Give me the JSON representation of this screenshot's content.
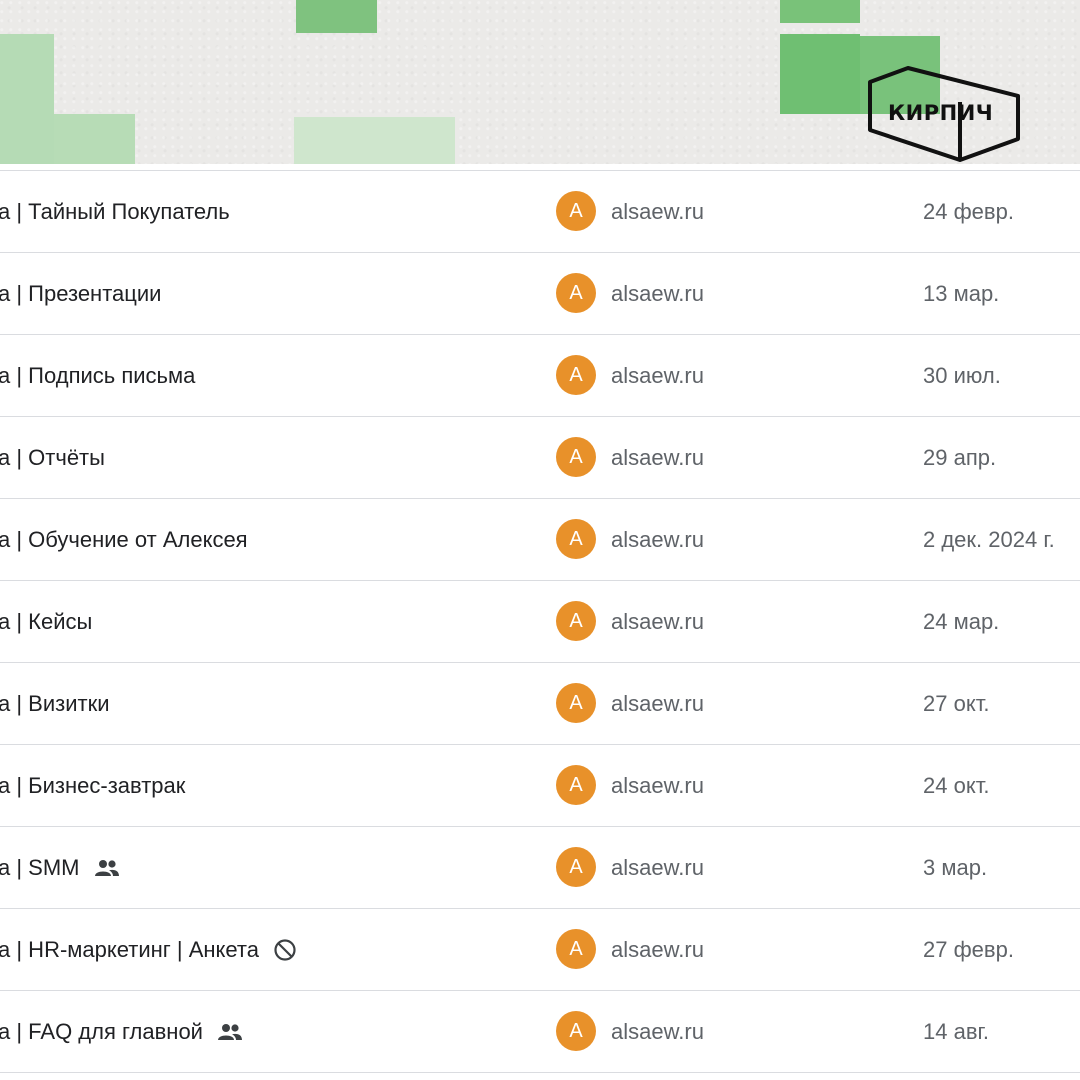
{
  "header": {
    "logo_text": "КИРПИЧ"
  },
  "colors": {
    "avatar_bg": "#e8912a",
    "divider": "#dadce0",
    "text_primary": "#202124",
    "text_secondary": "#5f6368"
  },
  "rows": [
    {
      "title": "а | Тайный Покупатель",
      "avatar_letter": "A",
      "owner": "alsaew.ru",
      "date": "24 февр.",
      "flag_icon": ""
    },
    {
      "title": "а | Презентации",
      "avatar_letter": "A",
      "owner": "alsaew.ru",
      "date": "13 мар.",
      "flag_icon": ""
    },
    {
      "title": "а | Подпись письма",
      "avatar_letter": "A",
      "owner": "alsaew.ru",
      "date": "30 июл.",
      "flag_icon": ""
    },
    {
      "title": "а | Отчёты",
      "avatar_letter": "A",
      "owner": "alsaew.ru",
      "date": "29 апр.",
      "flag_icon": ""
    },
    {
      "title": "а | Обучение от Алексея",
      "avatar_letter": "A",
      "owner": "alsaew.ru",
      "date": "2 дек. 2024 г.",
      "flag_icon": ""
    },
    {
      "title": "а | Кейсы",
      "avatar_letter": "A",
      "owner": "alsaew.ru",
      "date": "24 мар.",
      "flag_icon": ""
    },
    {
      "title": "а | Визитки",
      "avatar_letter": "A",
      "owner": "alsaew.ru",
      "date": "27 окт.",
      "flag_icon": ""
    },
    {
      "title": "а | Бизнес-завтрак",
      "avatar_letter": "A",
      "owner": "alsaew.ru",
      "date": "24 окт.",
      "flag_icon": ""
    },
    {
      "title": "а | SMM",
      "avatar_letter": "A",
      "owner": "alsaew.ru",
      "date": "3 мар.",
      "flag_icon": "shared-people-icon"
    },
    {
      "title": "а | HR-маркетинг | Анкета",
      "avatar_letter": "A",
      "owner": "alsaew.ru",
      "date": "27 февр.",
      "flag_icon": "blocked-icon"
    },
    {
      "title": "а | FAQ для главной",
      "avatar_letter": "A",
      "owner": "alsaew.ru",
      "date": "14 авг.",
      "flag_icon": "shared-people-icon"
    }
  ]
}
